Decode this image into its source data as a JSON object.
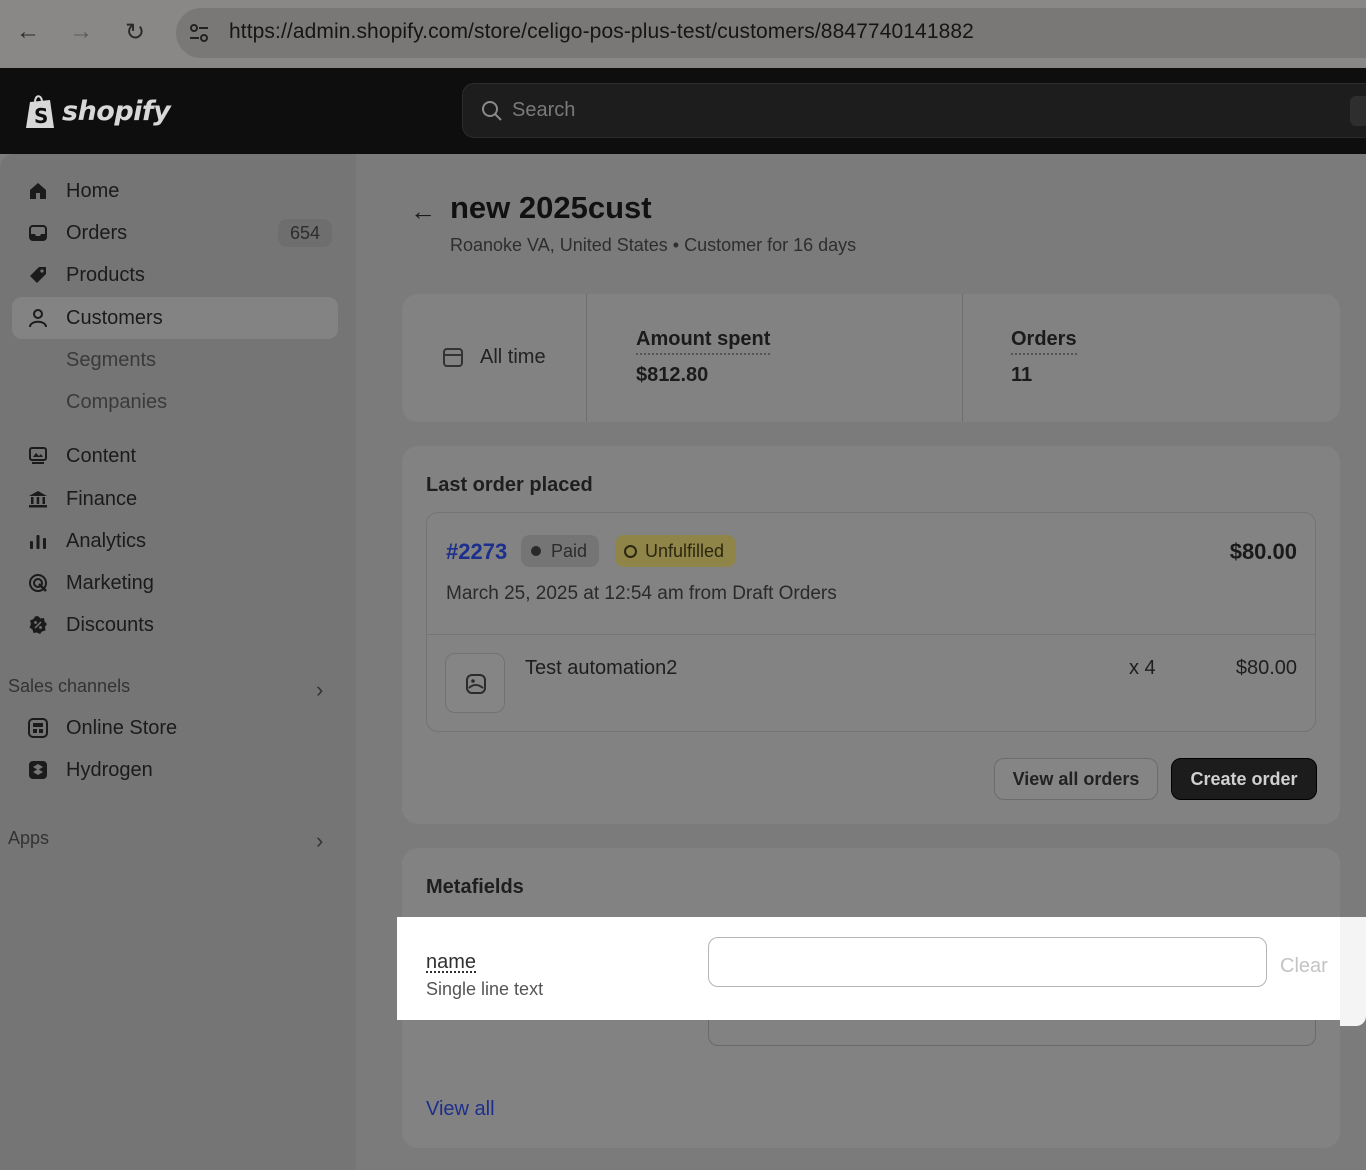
{
  "browser": {
    "url": "https://admin.shopify.com/store/celigo-pos-plus-test/customers/8847740141882"
  },
  "topbar": {
    "logo_text": "shopify",
    "search_placeholder": "Search"
  },
  "sidebar": {
    "items": [
      {
        "label": "Home",
        "icon": "home-icon"
      },
      {
        "label": "Orders",
        "icon": "inbox-icon",
        "badge": "654"
      },
      {
        "label": "Products",
        "icon": "tag-icon"
      },
      {
        "label": "Customers",
        "icon": "person-icon",
        "active": true
      },
      {
        "label": "Segments"
      },
      {
        "label": "Companies"
      },
      {
        "label": "Content",
        "icon": "content-icon"
      },
      {
        "label": "Finance",
        "icon": "bank-icon"
      },
      {
        "label": "Analytics",
        "icon": "bar-chart-icon"
      },
      {
        "label": "Marketing",
        "icon": "target-icon"
      },
      {
        "label": "Discounts",
        "icon": "discount-icon"
      }
    ],
    "sales_channels_label": "Sales channels",
    "channels": [
      {
        "label": "Online Store",
        "icon": "store-icon"
      },
      {
        "label": "Hydrogen",
        "icon": "hydrogen-icon"
      }
    ],
    "apps_label": "Apps"
  },
  "customer": {
    "name": "new 2025cust",
    "subtitle": "Roanoke VA, United States • Customer for 16 days"
  },
  "stats": {
    "range_label": "All time",
    "amount_spent_label": "Amount spent",
    "amount_spent_value": "$812.80",
    "orders_label": "Orders",
    "orders_value": "11"
  },
  "last_order": {
    "heading": "Last order placed",
    "number": "#2273",
    "payment_status": "Paid",
    "fulfillment_status": "Unfulfilled",
    "total": "$80.00",
    "date_line": "March 25, 2025 at 12:54 am from Draft Orders",
    "item_name": "Test automation2",
    "item_qty": "x 4",
    "item_price": "$80.00",
    "view_all_label": "View all orders",
    "create_label": "Create order"
  },
  "metafields": {
    "heading": "Metafields",
    "field_name": "name",
    "field_type": "Single line text",
    "field_value": "",
    "clear_label": "Clear",
    "view_all_label": "View all"
  }
}
